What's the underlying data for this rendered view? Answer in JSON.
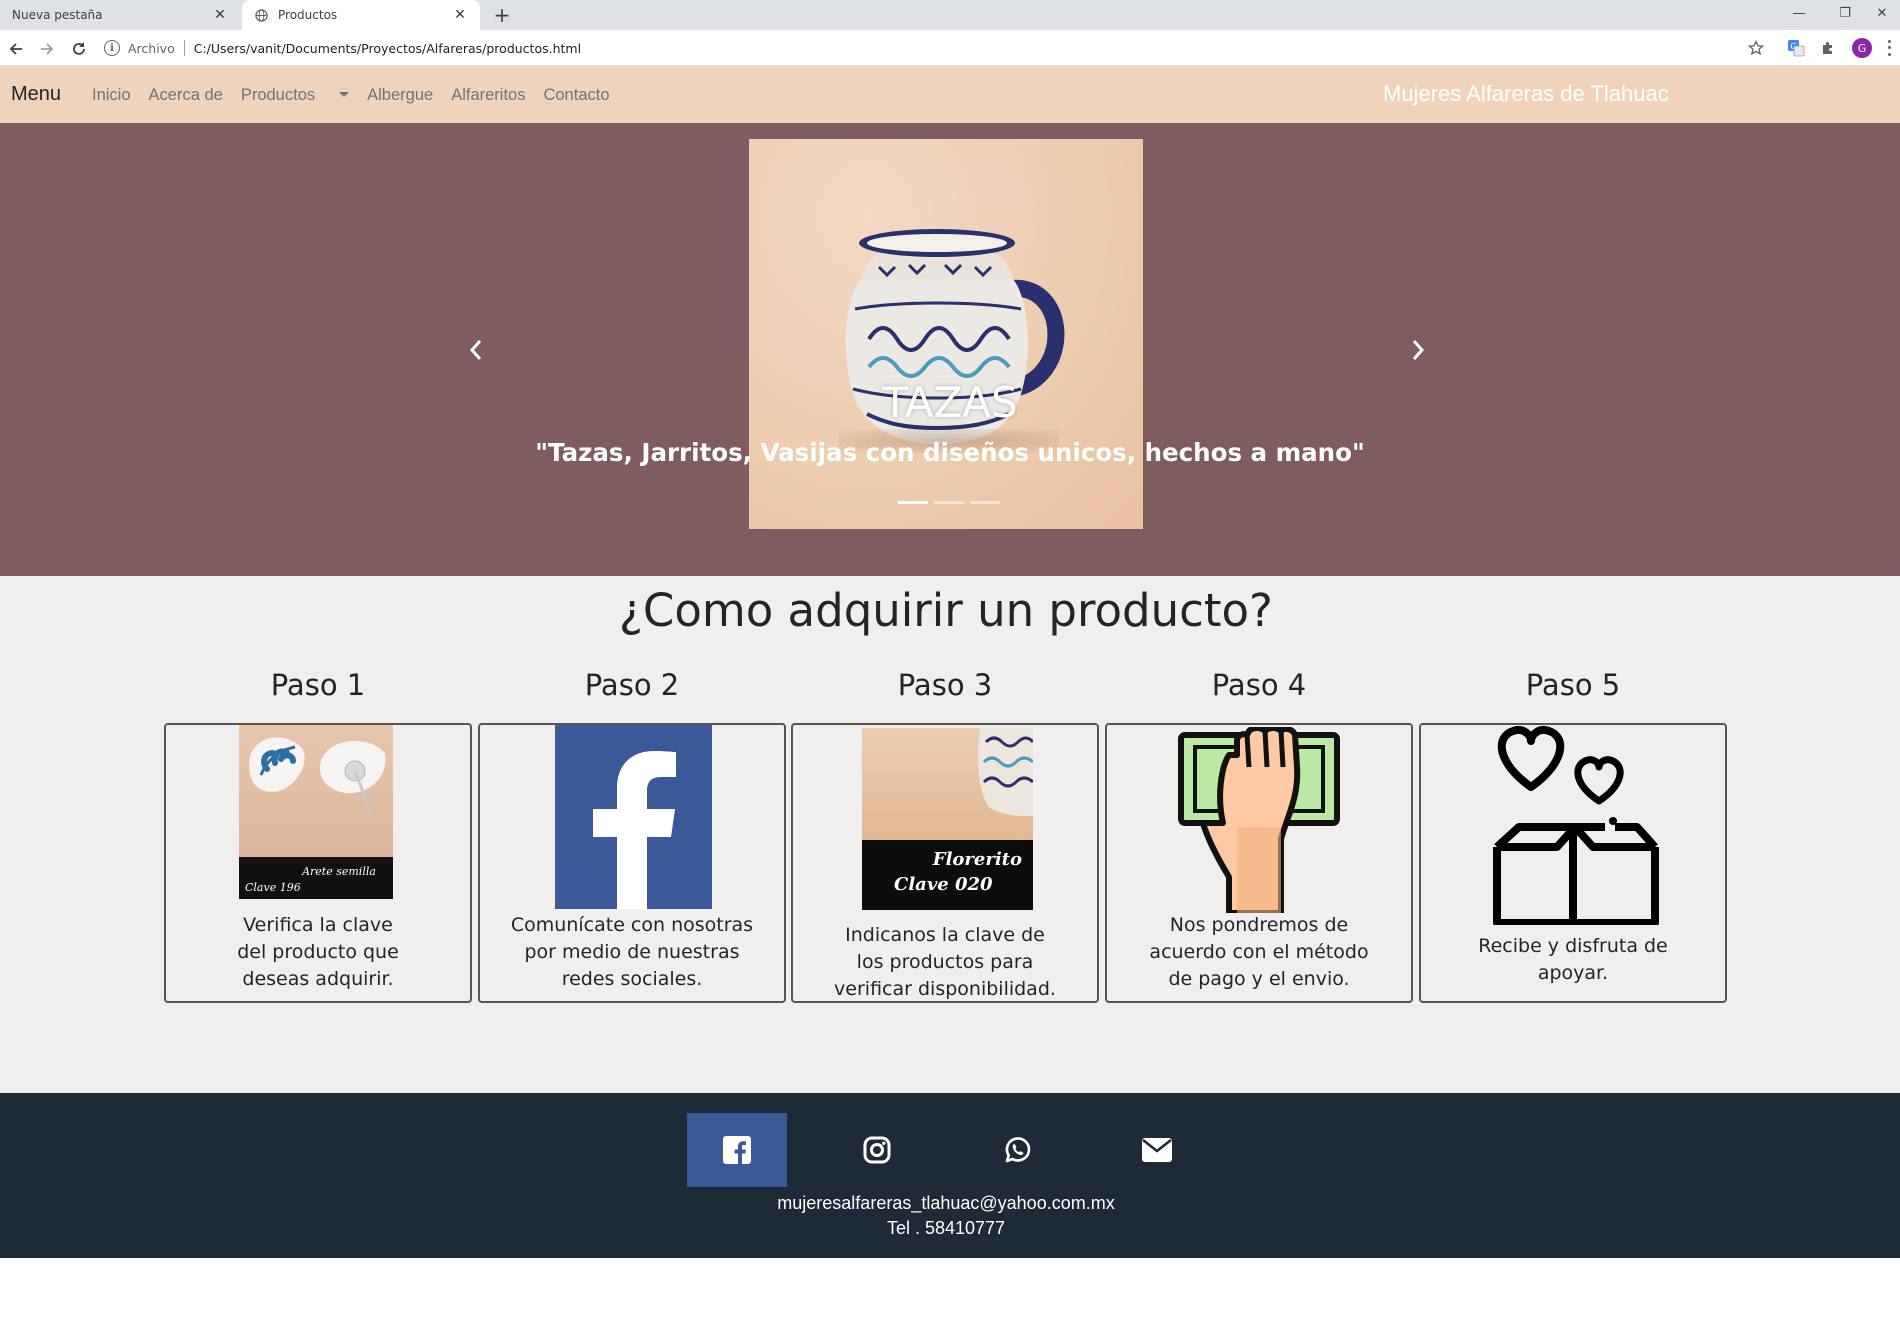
{
  "browser": {
    "tabs": [
      {
        "title": "Nueva pestaña",
        "active": false
      },
      {
        "title": "Productos",
        "active": true
      }
    ],
    "new_tab_label": "+",
    "omnibox": {
      "scheme_label": "Archivo",
      "url": "C:/Users/vanit/Documents/Proyectos/Alfareras/productos.html"
    },
    "profile_initial": "G"
  },
  "nav": {
    "brand": "Menu",
    "links": [
      {
        "label": "Inicio"
      },
      {
        "label": "Acerca de"
      },
      {
        "label": "Productos",
        "dropdown": true
      },
      {
        "label": "Albergue"
      },
      {
        "label": "Alfareritos"
      },
      {
        "label": "Contacto"
      }
    ],
    "site_title": "Mujeres Alfareras de Tlahuac"
  },
  "carousel": {
    "title": "TAZAS",
    "text": "\"Tazas, Jarritos, Vasijas con diseños unicos, hechos a mano\"",
    "slide_count": 3,
    "active_slide": 1
  },
  "steps": {
    "heading": "¿Como adquirir un producto?",
    "items": [
      {
        "label": "Paso 1",
        "image": "earring-product-photo",
        "image_caption_name": "Arete semilla",
        "image_caption_code": "Clave 196",
        "text": [
          "Verifica la clave",
          "del producto que",
          "deseas adquirir."
        ]
      },
      {
        "label": "Paso 2",
        "image": "facebook-logo",
        "text": [
          "Comunícate con nosotras",
          "por medio de nuestras",
          "redes sociales."
        ]
      },
      {
        "label": "Paso 3",
        "image": "mug-product-photo",
        "image_caption_name": "Florerito",
        "image_caption_code": "Clave 020",
        "text": [
          "Indicanos la clave de",
          "los productos para",
          "verificar disponibilidad."
        ]
      },
      {
        "label": "Paso 4",
        "image": "hand-holding-money-icon",
        "text": [
          "Nos pondremos de",
          "acuerdo con el método",
          "de pago  y el envio."
        ]
      },
      {
        "label": "Paso 5",
        "image": "gift-box-hearts-icon",
        "text": [
          "Recibe y disfruta de",
          "apoyar."
        ]
      }
    ]
  },
  "footer": {
    "social": [
      "facebook-icon",
      "instagram-icon",
      "whatsapp-icon",
      "envelope-icon"
    ],
    "email": "mujeresalfareras_tlahuac@yahoo.com.mx",
    "tel": "Tel . 58410777"
  },
  "colors": {
    "navbar_bg": "#f0d3bd",
    "carousel_bg": "#7f5c60",
    "steps_bg": "#f1efed",
    "footer_bg": "#1f2a38",
    "facebook_blue": "#3b5998",
    "money_green": "#bde8a6"
  }
}
